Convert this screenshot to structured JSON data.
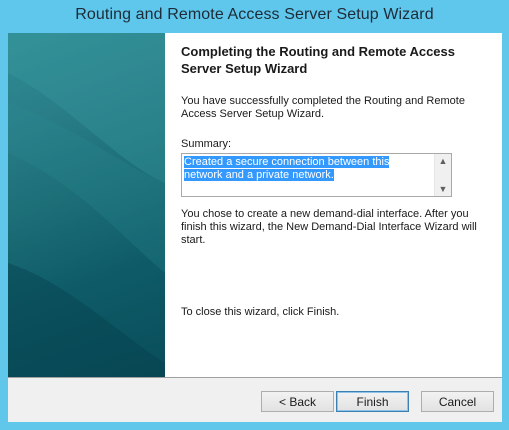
{
  "window": {
    "title": "Routing and Remote Access Server Setup Wizard"
  },
  "content": {
    "heading": "Completing the Routing and Remote Access Server Setup Wizard",
    "success_text": "You have successfully completed the Routing and Remote Access Server Setup Wizard.",
    "summary_label": "Summary:",
    "summary_text": "Created a secure connection between this network and a private network.",
    "demand_dial_text": "You chose to create a new demand-dial interface. After you finish this wizard, the New Demand-Dial Interface Wizard will start.",
    "close_text": "To close this wizard, click Finish."
  },
  "buttons": {
    "back": "< Back",
    "finish": "Finish",
    "cancel": "Cancel"
  },
  "colors": {
    "titlebar": "#5fc7ec",
    "banner": "#1d6f78",
    "selection": "#3399ff"
  }
}
